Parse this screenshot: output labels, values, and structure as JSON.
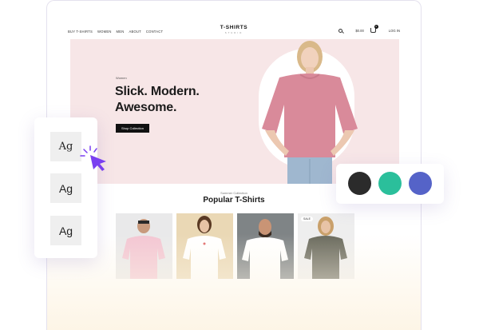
{
  "nav": {
    "links": [
      "BUY T-SHIRTS",
      "WOMEN",
      "MEN",
      "ABOUT",
      "CONTACT"
    ],
    "brand_title": "T-SHIRTS",
    "brand_sub": "STUDIO",
    "cart_total": "$0.00",
    "cart_count": "0",
    "login": "LOG IN"
  },
  "hero": {
    "eyebrow": "Women",
    "headline_line1": "Slick. Modern.",
    "headline_line2": "Awesome.",
    "cta": "Shop Collection"
  },
  "popular": {
    "eyebrow": "Summer Collection",
    "title": "Popular T-Shirts",
    "products": [
      {
        "shirt_color": "#f3c6d3"
      },
      {
        "shirt_color": "#ffffff"
      },
      {
        "shirt_color": "#ffffff"
      },
      {
        "shirt_color": "#6b6b5e",
        "tag": "SALE"
      }
    ]
  },
  "font_picker": {
    "samples": [
      "Ag",
      "Ag",
      "Ag"
    ]
  },
  "color_picker": {
    "colors": [
      "#2b2b2b",
      "#2bbf9b",
      "#5563c8"
    ]
  },
  "colors": {
    "hero_bg": "#f7e6e7",
    "accent_cursor": "#7a3ff0",
    "tshirt_pink": "#d98a9a"
  }
}
